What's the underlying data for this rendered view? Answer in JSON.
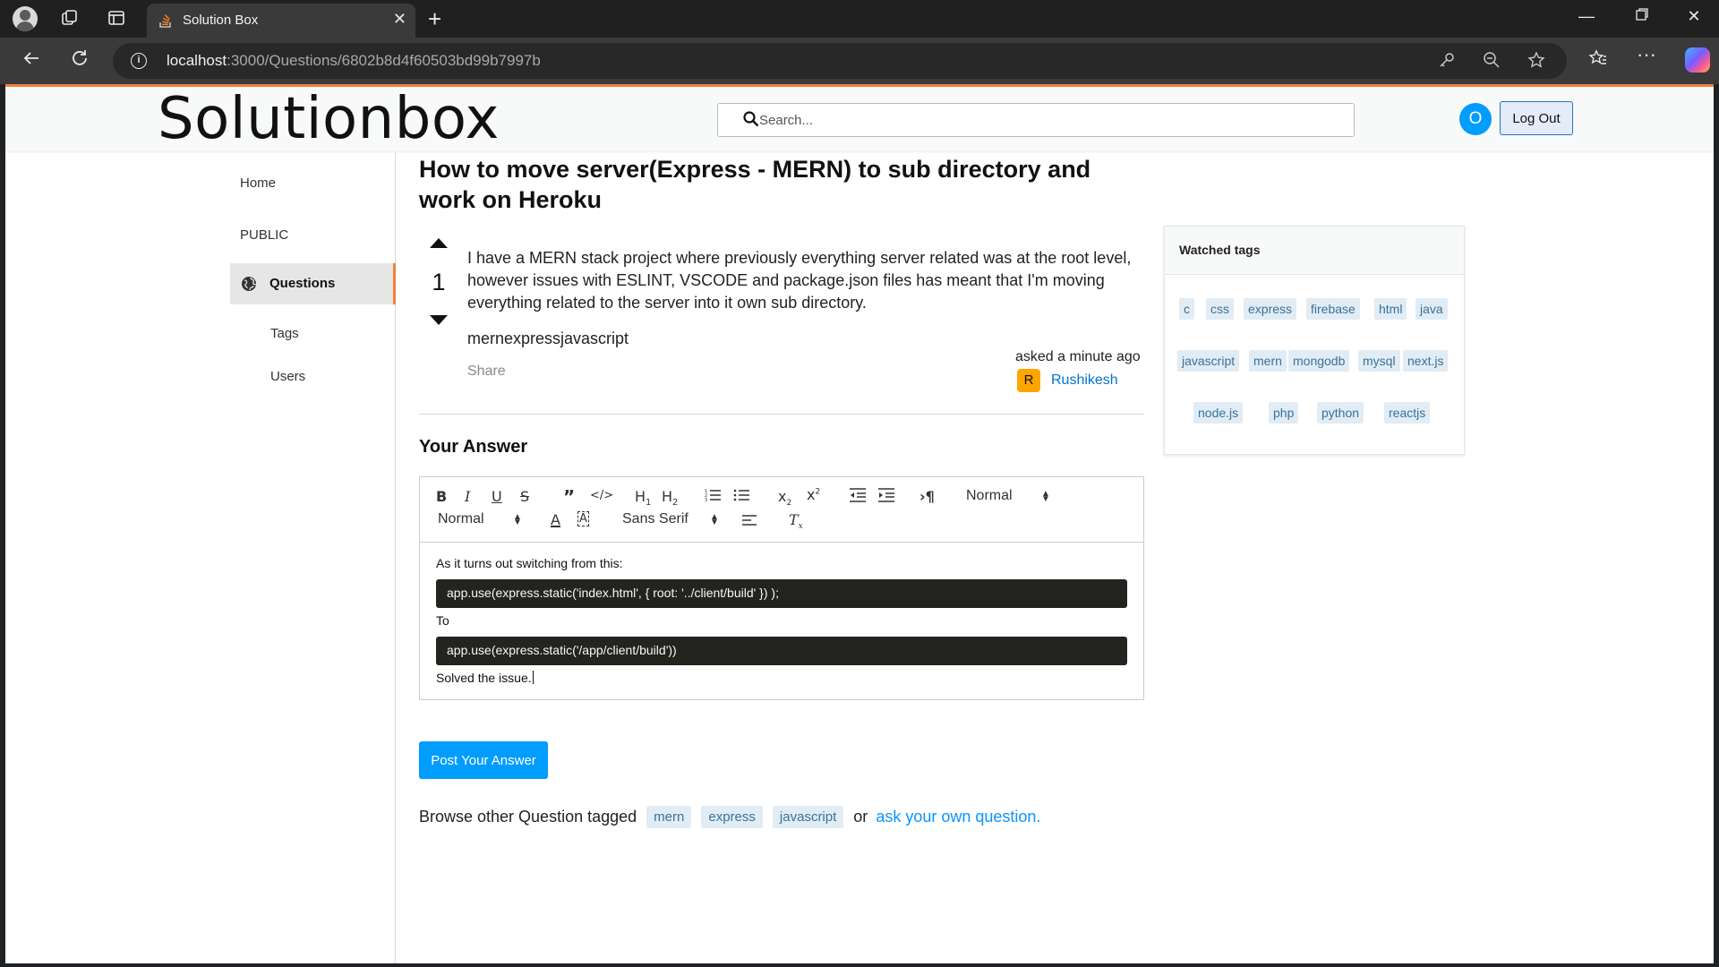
{
  "browser": {
    "tab_title": "Solution Box",
    "url_host": "localhost",
    "url_path": ":3000/Questions/6802b8d4f60503bd99b7997b"
  },
  "header": {
    "logo_text": "Solutionbox",
    "search_placeholder": "Search...",
    "avatar_initial": "O",
    "logout_label": "Log Out"
  },
  "sidebar": {
    "home": "Home",
    "public": "PUBLIC",
    "questions": "Questions",
    "tags": "Tags",
    "users": "Users"
  },
  "question": {
    "title": "How to move server(Express - MERN) to sub directory and work on Heroku",
    "votes": "1",
    "body": "I have a MERN stack project where previously everything server related was at the root level, however issues with ESLINT, VSCODE and package.json files has meant that I'm moving everything related to the server into it own sub directory.",
    "tags_text": "mernexpressjavascript",
    "share": "Share",
    "asked": "asked a minute ago",
    "asker_initial": "R",
    "asker_name": "Rushikesh"
  },
  "answer": {
    "heading": "Your Answer",
    "toolbar": {
      "header_select": "Normal",
      "size_select": "Normal",
      "font_select": "Sans Serif"
    },
    "content": {
      "line1": "As it turns out switching from this:",
      "code1": "app.use(express.static('index.html', { root: '../client/build' }) );",
      "line2": "To",
      "code2": "app.use(express.static('/app/client/build'))",
      "line3": "Solved the issue."
    },
    "post_label": "Post Your Answer"
  },
  "browse": {
    "prefix": "Browse other Question tagged",
    "tags": [
      "mern",
      "express",
      "javascript"
    ],
    "or": "or",
    "link": "ask your own question."
  },
  "watched": {
    "title": "Watched tags",
    "tags": [
      "c",
      "css",
      "express",
      "firebase",
      "html",
      "java",
      "javascript",
      "mern",
      "mongodb",
      "mysql",
      "next.js",
      "node.js",
      "php",
      "python",
      "reactjs"
    ]
  },
  "colors": {
    "accent": "#ef8236",
    "primary": "#009dff",
    "tag_bg": "#e1ecf4",
    "tag_text": "#39739d",
    "link": "#0074cc"
  }
}
